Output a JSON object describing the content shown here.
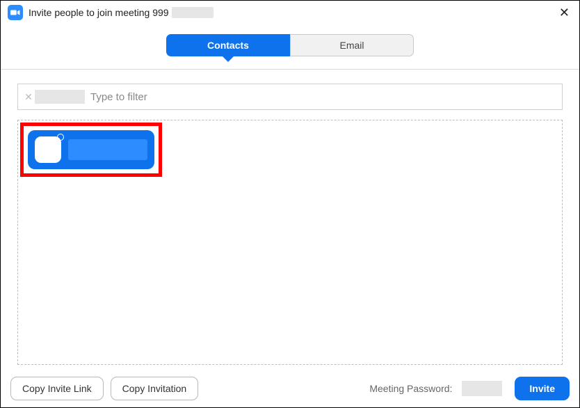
{
  "window": {
    "title_prefix": "Invite people to join meeting 999",
    "title_redacted_suffix": true
  },
  "tabs": {
    "contacts": "Contacts",
    "email": "Email",
    "active": "contacts"
  },
  "filter": {
    "placeholder": "Type to filter",
    "selected_chip_redacted": true
  },
  "contacts": {
    "items": [
      {
        "name_redacted": true,
        "selected": true,
        "highlighted": true
      }
    ]
  },
  "footer": {
    "copy_link": "Copy Invite Link",
    "copy_invitation": "Copy Invitation",
    "meeting_password_label": "Meeting Password:",
    "meeting_password_redacted": true,
    "invite": "Invite"
  },
  "colors": {
    "accent": "#0E72ED",
    "highlight": "#f00"
  }
}
